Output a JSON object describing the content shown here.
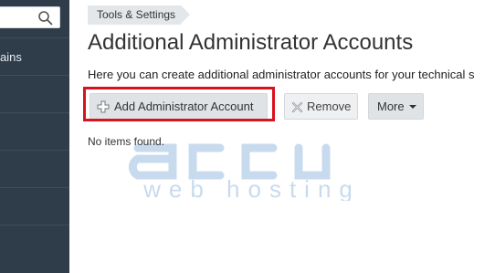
{
  "sidebar": {
    "search": {
      "placeholder": "",
      "icon": "search-icon"
    },
    "items": [
      {
        "label": "ains"
      },
      {
        "label": ""
      },
      {
        "label": ""
      },
      {
        "label": ""
      },
      {
        "label": ""
      },
      {
        "label": ""
      }
    ]
  },
  "breadcrumb": {
    "label": "Tools & Settings"
  },
  "page": {
    "title": "Additional Administrator Accounts",
    "description": "Here you can create additional administrator accounts for your technical s"
  },
  "toolbar": {
    "add_label": "Add Administrator Account",
    "remove_label": "Remove",
    "more_label": "More"
  },
  "list": {
    "empty_message": "No items found."
  },
  "watermark": {
    "brand": "accu",
    "tagline": "web hosting"
  },
  "colors": {
    "sidebar_bg": "#2f3c4a",
    "highlight": "#d7131d",
    "button_bg": "#dfe3e6",
    "watermark": "#c8dbee"
  }
}
